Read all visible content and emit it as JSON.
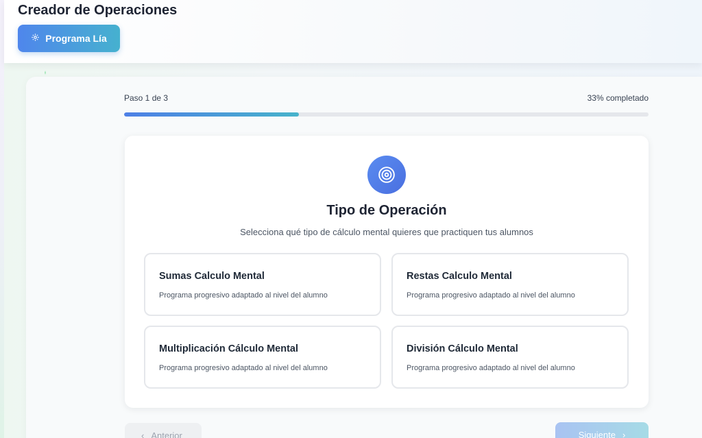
{
  "header": {
    "title": "Creador de Operaciones",
    "program_button_label": "Programa Lía"
  },
  "progress": {
    "step_label": "Paso 1 de 3",
    "percent_label": "33% completado",
    "fraction": 0.333
  },
  "step": {
    "icon": "target-icon",
    "title": "Tipo de Operación",
    "subtitle": "Selecciona qué tipo de cálculo mental quieres que practiquen tus alumnos",
    "options": [
      {
        "title": "Sumas Calculo Mental",
        "description": "Programa progresivo adaptado al nivel del alumno"
      },
      {
        "title": "Restas Calculo Mental",
        "description": "Programa progresivo adaptado al nivel del alumno"
      },
      {
        "title": "Multiplicación Cálculo Mental",
        "description": "Programa progresivo adaptado al nivel del alumno"
      },
      {
        "title": "División Cálculo Mental",
        "description": "Programa progresivo adaptado al nivel del alumno"
      }
    ]
  },
  "nav": {
    "prev_label": "Anterior",
    "next_label": "Siguiente"
  },
  "colors": {
    "accent_start": "#4f86ec",
    "accent_end": "#46b1cf",
    "text_dark": "#1e2433"
  }
}
